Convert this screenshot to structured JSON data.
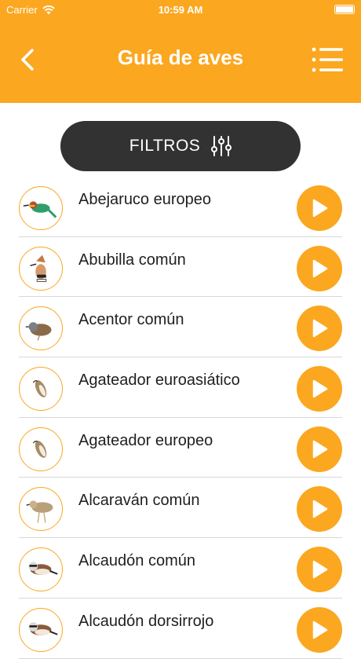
{
  "status_bar": {
    "carrier": "Carrier",
    "time": "10:59 AM"
  },
  "nav": {
    "title": "Guía de aves",
    "back_icon": "chevron-left-icon",
    "menu_icon": "list-icon"
  },
  "filters": {
    "label": "FILTROS",
    "icon": "sliders-icon"
  },
  "colors": {
    "accent": "#fba720",
    "dark_button": "#323232",
    "separator": "#d8d8d8"
  },
  "birds": [
    {
      "name": "Abejaruco europeo",
      "art": "bee-eater"
    },
    {
      "name": "Abubilla común",
      "art": "hoopoe"
    },
    {
      "name": "Acentor común",
      "art": "dunnock"
    },
    {
      "name": "Agateador euroasiático",
      "art": "treecreeper"
    },
    {
      "name": "Agateador europeo",
      "art": "treecreeper"
    },
    {
      "name": "Alcaraván común",
      "art": "stone-curlew"
    },
    {
      "name": "Alcaudón común",
      "art": "shrike"
    },
    {
      "name": "Alcaudón dorsirrojo",
      "art": "shrike"
    }
  ]
}
